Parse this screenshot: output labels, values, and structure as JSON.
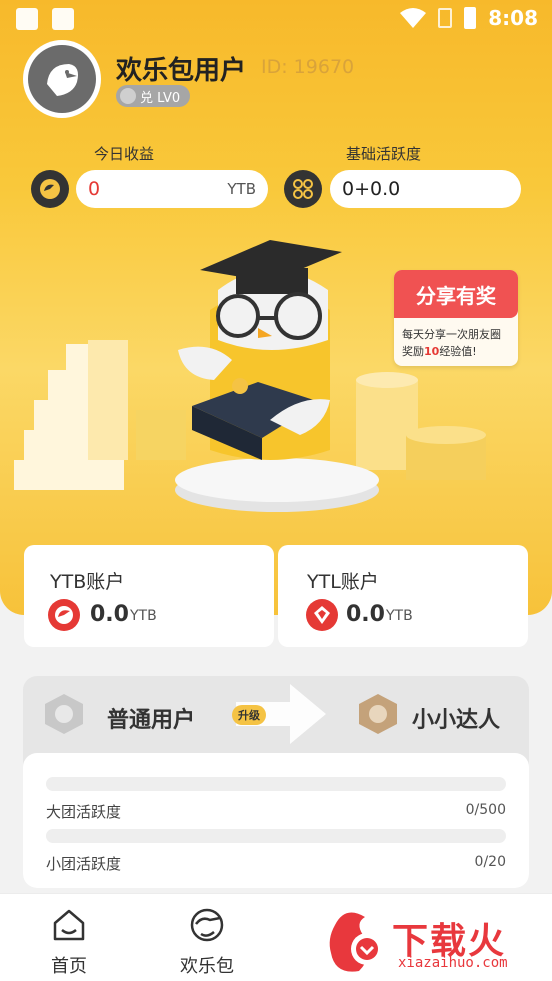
{
  "status_bar": {
    "time": "8:08"
  },
  "profile": {
    "username": "欢乐包用户",
    "user_id": "ID: 19670",
    "level_badge": "兑 LV0"
  },
  "stats": {
    "today_income_label": "今日收益",
    "today_income_value": "0",
    "today_income_unit": "YTB",
    "activity_label": "基础活跃度",
    "activity_value": "0+0.0"
  },
  "promo": {
    "title": "分享有奖",
    "desc_line1": "每天分享一次朋友圈",
    "desc_line2_pre": "奖励",
    "desc_line2_num": "10",
    "desc_line2_post": "经验值!"
  },
  "accounts": [
    {
      "title": "YTB账户",
      "value": "0.0",
      "unit": "YTB",
      "icon": "ytb-coin-icon",
      "color": "#e53935"
    },
    {
      "title": "YTL账户",
      "value": "0.0",
      "unit": "YTB",
      "icon": "ytl-gem-icon",
      "color": "#e53935"
    }
  ],
  "levels": {
    "current": "普通用户",
    "upgrade_label": "升级",
    "next": "小小达人"
  },
  "progress": [
    {
      "label": "大团活跃度",
      "count": "0/500",
      "fraction": 0
    },
    {
      "label": "小团活跃度",
      "count": "0/20",
      "fraction": 0
    }
  ],
  "nav": [
    {
      "label": "首页",
      "icon": "home-icon"
    },
    {
      "label": "欢乐包",
      "icon": "bird-face-icon"
    }
  ],
  "watermark": {
    "text": "下载火",
    "url": "xiazaihuo.com"
  },
  "colors": {
    "hero": "#f9c83a",
    "accent_red": "#e53935",
    "bar_fill": "#f5b82e"
  }
}
